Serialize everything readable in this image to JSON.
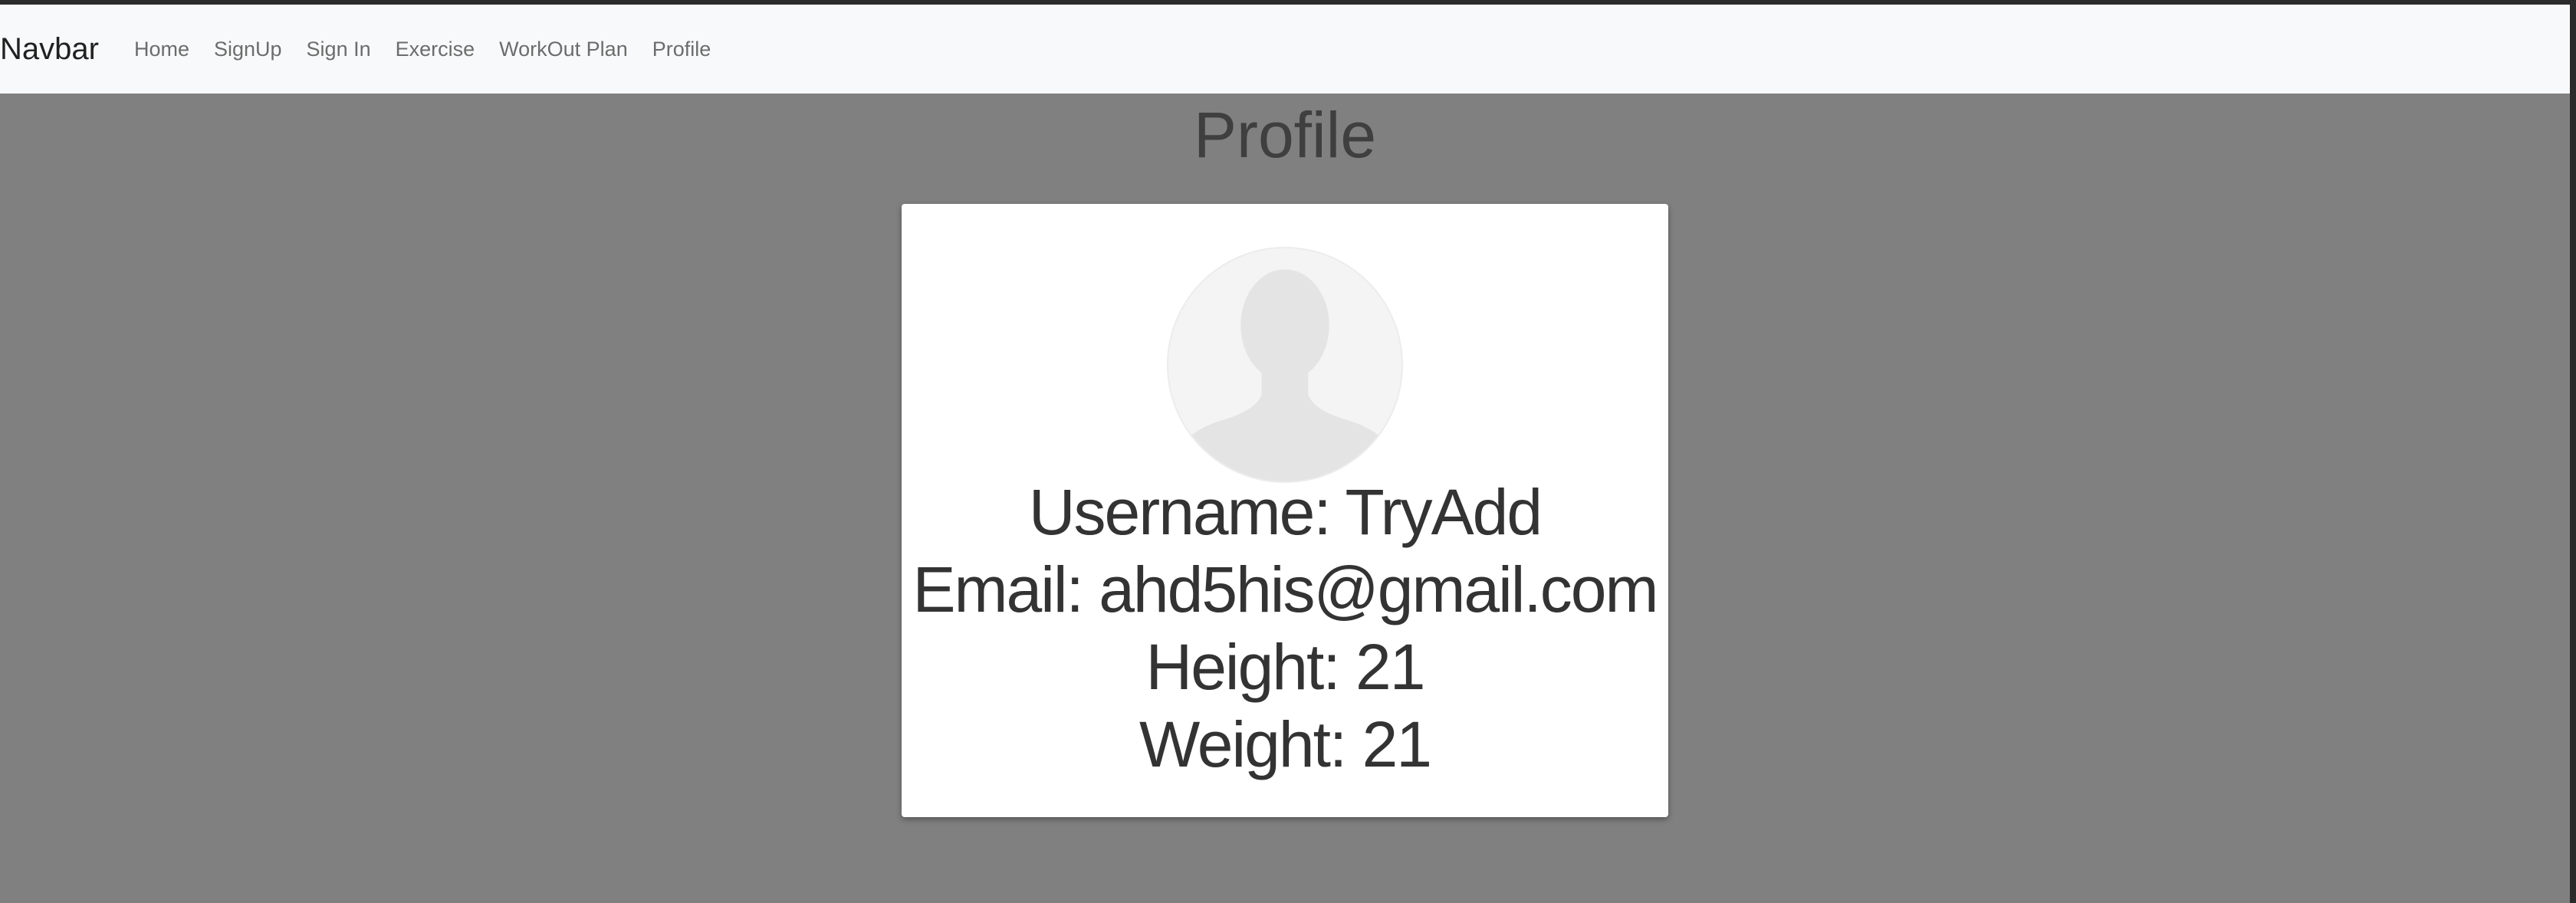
{
  "navbar": {
    "brand": "Navbar",
    "links": [
      "Home",
      "SignUp",
      "Sign In",
      "Exercise",
      "WorkOut Plan",
      "Profile"
    ]
  },
  "page": {
    "title": "Profile"
  },
  "profile": {
    "username": "Username: TryAdd",
    "email": "Email: ahd5his@gmail.com",
    "height": "Height: 21",
    "weight": "Weight: 21"
  },
  "colors": {
    "background": "#808080",
    "navbar": "#f8f9fa",
    "card": "#ffffff",
    "text": "#333333"
  },
  "icons": {
    "avatar": "default-user-silhouette-icon"
  }
}
